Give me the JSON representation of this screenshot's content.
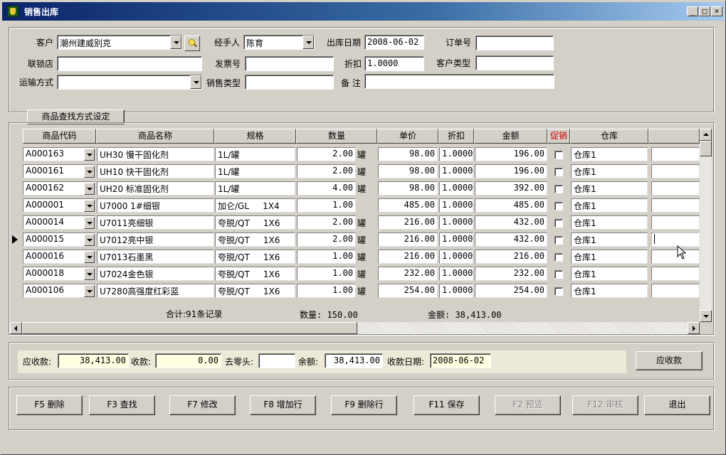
{
  "window": {
    "title": "销售出库",
    "controls": [
      "_",
      "□",
      "×"
    ]
  },
  "form": {
    "customer_label": "客户",
    "customer_value": "潮州建威别克",
    "handler_label": "经手人",
    "handler_value": "陈育",
    "out_date_label": "出库日期",
    "out_date_value": "2008-06-02",
    "order_no_label": "订单号",
    "order_no_value": "",
    "chain_store_label": "联锁店",
    "chain_store_value": "",
    "invoice_label": "发票号",
    "invoice_value": "",
    "discount_label": "折扣",
    "discount_value": "1.0000",
    "customer_type_label": "客户类型",
    "customer_type_value": "",
    "shipping_label": "运输方式",
    "shipping_value": "",
    "sales_type_label": "销售类型",
    "sales_type_value": "",
    "remark_label": "备 注",
    "remark_value": ""
  },
  "product_search_tab": "商品查找方式设定",
  "grid": {
    "headers": [
      "商品代码",
      "商品名称",
      "规格",
      "数量",
      "单价",
      "折扣",
      "金额",
      "促销",
      "仓库",
      ""
    ],
    "promo_header_color": "#cc0000",
    "current_row_index": 5,
    "rows": [
      {
        "code": "A000163",
        "name": "UH30  慢干固化剂",
        "spec": "1L/罐",
        "qty": "2.00",
        "unit": "罐",
        "price": "98.00",
        "discount": "1.0000",
        "amount": "196.00",
        "warehouse": "仓库1"
      },
      {
        "code": "A000161",
        "name": "UH10 快干固化剂",
        "spec": "1L/罐",
        "qty": "2.00",
        "unit": "罐",
        "price": "98.00",
        "discount": "1.0000",
        "amount": "196.00",
        "warehouse": "仓库1"
      },
      {
        "code": "A000162",
        "name": "UH20  标准固化剂",
        "spec": "1L/罐",
        "qty": "4.00",
        "unit": "罐",
        "price": "98.00",
        "discount": "1.0000",
        "amount": "392.00",
        "warehouse": "仓库1"
      },
      {
        "code": "A000001",
        "name": "U7000 1#细银",
        "spec": "加仑/GL     1X4",
        "qty": "1.00",
        "unit": "",
        "price": "485.00",
        "discount": "1.0000",
        "amount": "485.00",
        "warehouse": "仓库1"
      },
      {
        "code": "A000014",
        "name": "U7011亮细银",
        "spec": "夸脱/QT     1X6",
        "qty": "2.00",
        "unit": "罐",
        "price": "216.00",
        "discount": "1.0000",
        "amount": "432.00",
        "warehouse": "仓库1"
      },
      {
        "code": "A000015",
        "name": "U7012亮中银",
        "spec": "夸脱/QT     1X6",
        "qty": "2.00",
        "unit": "罐",
        "price": "216.00",
        "discount": "1.0000",
        "amount": "432.00",
        "warehouse": "仓库1"
      },
      {
        "code": "A000016",
        "name": "U7013石墨黑",
        "spec": "夸脱/QT     1X6",
        "qty": "1.00",
        "unit": "罐",
        "price": "216.00",
        "discount": "1.0000",
        "amount": "216.00",
        "warehouse": "仓库1"
      },
      {
        "code": "A000018",
        "name": "U7024金色银",
        "spec": "夸脱/QT     1X6",
        "qty": "1.00",
        "unit": "罐",
        "price": "232.00",
        "discount": "1.0000",
        "amount": "232.00",
        "warehouse": "仓库1"
      },
      {
        "code": "A000106",
        "name": "U7280高强度红彩蓝",
        "spec": "夸脱/QT     1X6",
        "qty": "1.00",
        "unit": "罐",
        "price": "254.00",
        "discount": "1.0000",
        "amount": "254.00",
        "warehouse": "仓库1"
      }
    ]
  },
  "totals": {
    "records": "合计:91条记录",
    "quantity": "数量: 150.00",
    "amount": "金额: 38,413.00"
  },
  "payment": {
    "receivable_label": "应收款:",
    "receivable_value": "38,413.00",
    "received_label": "收款:",
    "received_value": "0.00",
    "rounding_label": "去零头:",
    "rounding_value": "",
    "balance_label": "余额:",
    "balance_value": "38,413.00",
    "pay_date_label": "收款日期:",
    "pay_date_value": "2008-06-02",
    "receivable_button": "应收款"
  },
  "buttons": {
    "delete": "F5 删除",
    "find": "F3 查找",
    "modify": "F7 修改",
    "add_row": "F8 增加行",
    "delete_row": "F9 删除行",
    "save": "F11 保存",
    "preview": "F2 预览",
    "audit": "F12 审核",
    "exit": "退出"
  }
}
